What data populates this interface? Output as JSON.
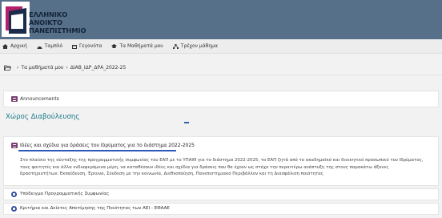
{
  "header": {
    "logo_lines": [
      "ΕΛΛΗΝΙΚΟ",
      "ΑΝΟΙΚΤΟ",
      "ΠΑΝΕΠΙΣΤΗΜΙΟ"
    ],
    "background": "#56708a"
  },
  "nav": {
    "items": [
      {
        "label": "Αρχική",
        "icon": "home-icon"
      },
      {
        "label": "Ταμπλό",
        "icon": "dashboard-icon"
      },
      {
        "label": "Γεγονότα",
        "icon": "calendar-icon"
      },
      {
        "label": "Τα Μαθήματά μου",
        "icon": "courses-icon"
      },
      {
        "label": "Τρέχον μάθημα",
        "icon": "sitemap-icon"
      }
    ]
  },
  "breadcrumb": {
    "icon": "folder-open-icon",
    "items": [
      "Τα μαθήματά μου",
      "ΔΙΑΒ_ΙΔΡ_ΔΡΑ_2022-25"
    ],
    "separator": "›"
  },
  "announcements": {
    "label": "Announcements",
    "icon": "forum-icon"
  },
  "section": {
    "title": "Χώρος Διαβούλευσης",
    "title_color": "#1c7a8a"
  },
  "forum": {
    "title": "Ιδέες και σχέδια για δράσεις του Ιδρύματος για το διάστημα 2022-2025",
    "description_lines": [
      "Στο πλαίσιο της σύνταξης της προγραμματικής συμφωνίας του ΕΑΠ με το ΥΠΑΙΘ για το διάστημα 2022-2025, το ΕΑΠ ζητά από το ακαδημαϊκό και διοικητικό προσωπικό του Ιδρύματος,",
      "τους φοιτητές και άλλα ενδιαφερόμενα μέρη, να καταθέσουν ιδέες και σχέδια για δράσεις που θα έχουν ως στόχο την περαιτέρω ανάπτυξη της στους παρακάτω άξονες",
      "δραστηριοτήτων: Εκπαίδευση, Έρευνα, Σύνδεση με την κοινωνία, Διεθνοποίηση, Πανεπιστημιακό Περιβάλλον και τη Διασφάλιση ποιότητας"
    ]
  },
  "resources": [
    {
      "label": "Υπόδειγμα Προγραμματικής Συμφωνίας",
      "icon": "document-icon"
    },
    {
      "label": "Κριτήρια και Δείκτες Αποτίμησης της Ποιότητας των ΑΕΙ - ΕΘΑΑΕ",
      "icon": "document-icon"
    }
  ]
}
